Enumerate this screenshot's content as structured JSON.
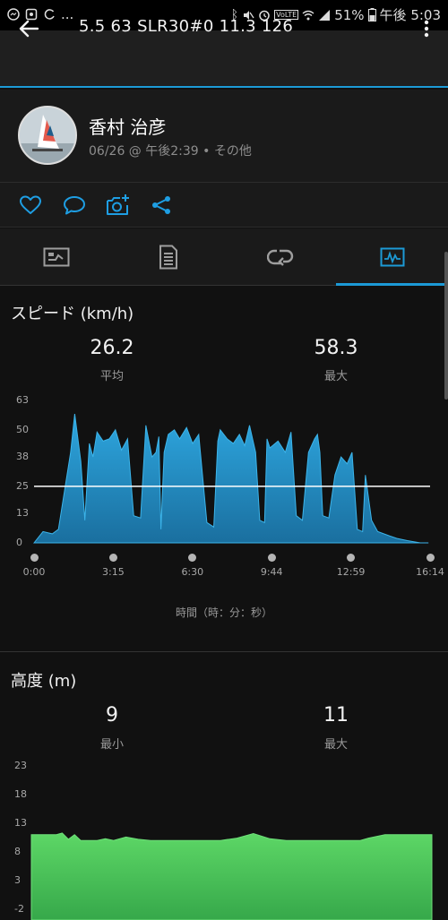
{
  "status_bar": {
    "left_text": "...",
    "battery": "51%",
    "time": "午後 5:03",
    "icons_left": [
      "messenger-icon",
      "gallery-icon",
      "sync-icon"
    ],
    "icons_right": [
      "bluetooth-icon",
      "mute-icon",
      "alarm-icon",
      "volte-icon",
      "wifi-icon",
      "signal-icon",
      "battery-icon"
    ]
  },
  "app_bar": {
    "title": "5.5  63  SLR30#0  11.3  126"
  },
  "profile": {
    "name": "香村 治彦",
    "meta": "06/26 @ 午後2:39 • その他"
  },
  "actions": [
    "like-icon",
    "comment-icon",
    "add-photo-icon",
    "share-icon"
  ],
  "tabs": [
    {
      "name": "summary",
      "icon": "summary-icon"
    },
    {
      "name": "details",
      "icon": "details-icon"
    },
    {
      "name": "laps",
      "icon": "laps-icon"
    },
    {
      "name": "charts",
      "icon": "charts-icon",
      "active": true
    }
  ],
  "speed": {
    "title": "スピード (km/h)",
    "avg_value": "26.2",
    "avg_label": "平均",
    "max_value": "58.3",
    "max_label": "最大",
    "x_caption": "時間（時：分：秒）"
  },
  "elevation": {
    "title": "高度 (m)",
    "min_value": "9",
    "min_label": "最小",
    "max_value": "11",
    "max_label": "最大"
  },
  "chart_data": [
    {
      "type": "area",
      "title": "スピード (km/h)",
      "xlabel": "時間（時：分：秒）",
      "ylabel": "",
      "x_ticks": [
        "0:00",
        "3:15",
        "6:30",
        "9:44",
        "12:59",
        "16:14"
      ],
      "y_ticks": [
        "0",
        "13",
        "25",
        "38",
        "50",
        "63"
      ],
      "ylim": [
        0,
        63
      ],
      "xlim_seconds": [
        0,
        974
      ],
      "average_line": 25,
      "color": "#1c8fc9",
      "series": [
        {
          "x_seconds": [
            0,
            22,
            45,
            60,
            90,
            100,
            115,
            125,
            136,
            145,
            155,
            170,
            185,
            200,
            215,
            230,
            245,
            262,
            275,
            290,
            300,
            307,
            312,
            320,
            330,
            345,
            358,
            375,
            390,
            405,
            425,
            442,
            452,
            458,
            475,
            490,
            505,
            518,
            530,
            545,
            555,
            567,
            573,
            580,
            600,
            618,
            632,
            645,
            660,
            675,
            690,
            697,
            703,
            710,
            725,
            740,
            755,
            770,
            782,
            795,
            808,
            815,
            830,
            845,
            860,
            875,
            892,
            918,
            950,
            970
          ],
          "values": [
            0,
            5,
            4,
            6,
            40,
            57,
            36,
            10,
            44,
            38,
            49,
            45,
            46,
            50,
            41,
            46,
            12,
            11,
            52,
            38,
            40,
            47,
            6,
            40,
            48,
            50,
            46,
            51,
            44,
            48,
            9,
            7,
            45,
            50,
            46,
            44,
            48,
            43,
            52,
            40,
            10,
            9,
            46,
            42,
            45,
            40,
            49,
            12,
            10,
            40,
            46,
            48,
            40,
            12,
            11,
            30,
            38,
            35,
            40,
            6,
            5,
            30,
            10,
            5,
            4,
            3,
            2,
            1,
            0,
            0
          ]
        }
      ]
    },
    {
      "type": "area",
      "title": "高度 (m)",
      "y_ticks": [
        "-2",
        "3",
        "8",
        "13",
        "18",
        "23"
      ],
      "ylim": [
        -2,
        23
      ],
      "color": "#4ecf5a",
      "series": [
        {
          "x_seconds": [
            0,
            40,
            60,
            75,
            90,
            105,
            120,
            140,
            160,
            180,
            200,
            230,
            260,
            290,
            320,
            340,
            360,
            380,
            400,
            430,
            460,
            500,
            540,
            580,
            620,
            660,
            700,
            740,
            780,
            800,
            820,
            860,
            900,
            940,
            974
          ],
          "values": [
            11,
            11,
            11,
            11.3,
            10.2,
            11,
            10,
            10,
            10,
            10.3,
            10,
            10.6,
            10.2,
            10,
            10,
            10,
            10,
            10,
            10,
            10,
            10,
            10.4,
            11.2,
            10.3,
            10,
            10,
            10,
            10,
            10,
            10,
            10.4,
            11,
            11,
            11,
            11
          ]
        }
      ]
    }
  ]
}
